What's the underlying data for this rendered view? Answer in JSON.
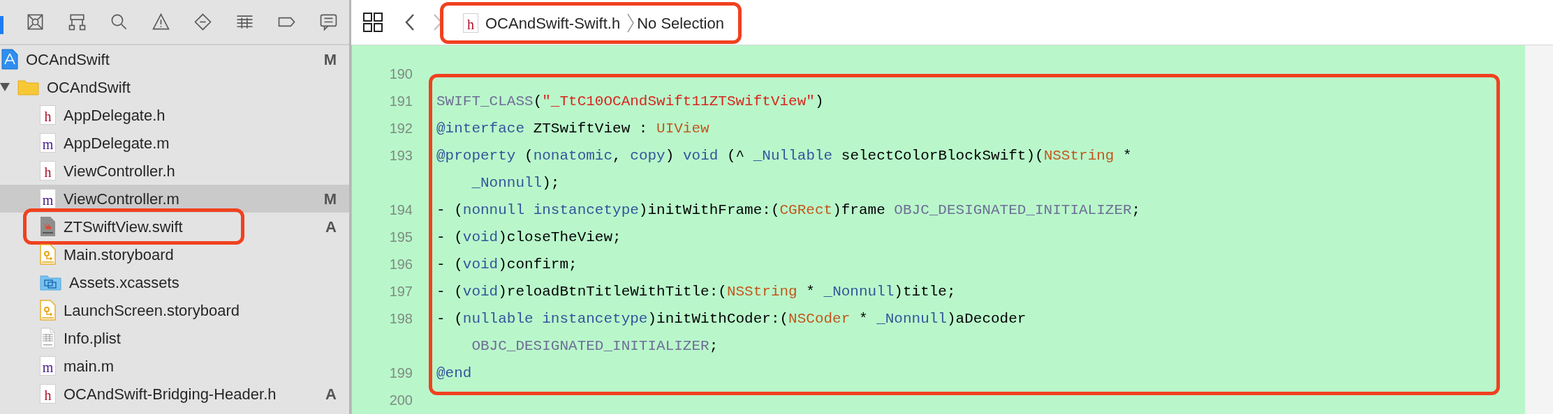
{
  "navigator": {
    "tree": [
      {
        "label": "OCAndSwift",
        "kind": "project",
        "status": "M",
        "selected": false,
        "highlighted": false
      },
      {
        "label": "OCAndSwift",
        "kind": "folder",
        "expanded": true,
        "selected": false,
        "highlighted": false,
        "children": [
          {
            "label": "AppDelegate.h",
            "kind": "header",
            "badge": "h",
            "selected": false,
            "highlighted": false
          },
          {
            "label": "AppDelegate.m",
            "kind": "source",
            "badge": "m",
            "selected": false,
            "highlighted": false
          },
          {
            "label": "ViewController.h",
            "kind": "header",
            "badge": "h",
            "selected": false,
            "highlighted": false
          },
          {
            "label": "ViewController.m",
            "kind": "source",
            "badge": "m",
            "status": "M",
            "selected": true,
            "highlighted": false
          },
          {
            "label": "ZTSwiftView.swift",
            "kind": "swift",
            "status": "A",
            "selected": false,
            "highlighted": true
          },
          {
            "label": "Main.storyboard",
            "kind": "storyboard",
            "selected": false,
            "highlighted": false
          },
          {
            "label": "Assets.xcassets",
            "kind": "assets",
            "selected": false,
            "highlighted": false
          },
          {
            "label": "LaunchScreen.storyboard",
            "kind": "storyboard",
            "selected": false,
            "highlighted": false
          },
          {
            "label": "Info.plist",
            "kind": "plist",
            "selected": false,
            "highlighted": false
          },
          {
            "label": "main.m",
            "kind": "source",
            "badge": "m",
            "selected": false,
            "highlighted": false
          },
          {
            "label": "OCAndSwift-Bridging-Header.h",
            "kind": "header",
            "badge": "h",
            "status": "A",
            "selected": false,
            "highlighted": false
          }
        ]
      }
    ]
  },
  "jump_bar": {
    "highlighted": true,
    "back_disabled": false,
    "forward_disabled": true,
    "file": {
      "badge": "h",
      "label": "OCAndSwift-Swift.h"
    },
    "symbol": "No Selection"
  },
  "code": {
    "lines": [
      {
        "number": "190",
        "highlighted": false
      },
      {
        "number": "191",
        "highlighted": true,
        "tokens": [
          {
            "t": "SWIFT_CLASS",
            "color": "#6e6e96"
          },
          {
            "t": "(",
            "color": "#000000"
          },
          {
            "t": "\"_TtC10OCAndSwift11ZTSwiftView\"",
            "color": "#d9261c"
          },
          {
            "t": ")",
            "color": "#000000"
          }
        ]
      },
      {
        "number": "192",
        "highlighted": true,
        "tokens": [
          {
            "t": "@interface",
            "color": "#34559a"
          },
          {
            "t": " ZTSwiftView : ",
            "color": "#000000"
          },
          {
            "t": "UIView",
            "color": "#c4561c"
          }
        ]
      },
      {
        "number": "193",
        "highlighted": true,
        "tokens": [
          {
            "t": "@property",
            "color": "#34559a"
          },
          {
            "t": " (",
            "color": "#000000"
          },
          {
            "t": "nonatomic",
            "color": "#34559a"
          },
          {
            "t": ", ",
            "color": "#000000"
          },
          {
            "t": "copy",
            "color": "#34559a"
          },
          {
            "t": ") ",
            "color": "#000000"
          },
          {
            "t": "void",
            "color": "#34559a"
          },
          {
            "t": " (^ ",
            "color": "#000000"
          },
          {
            "t": "_Nullable",
            "color": "#34559a"
          },
          {
            "t": " selectColorBlockSwift)(",
            "color": "#000000"
          },
          {
            "t": "NSString",
            "color": "#c4561c"
          },
          {
            "t": " * ",
            "color": "#000000"
          },
          {
            "t": "_Nonnull",
            "color": "#34559a"
          },
          {
            "t": ");",
            "color": "#000000"
          }
        ]
      },
      {
        "number": "194",
        "highlighted": true,
        "tokens": [
          {
            "t": "- (",
            "color": "#000000"
          },
          {
            "t": "nonnull instancetype",
            "color": "#34559a"
          },
          {
            "t": ")initWithFrame:(",
            "color": "#000000"
          },
          {
            "t": "CGRect",
            "color": "#c4561c"
          },
          {
            "t": ")frame ",
            "color": "#000000"
          },
          {
            "t": "OBJC_DESIGNATED_INITIALIZER",
            "color": "#6e6e96"
          },
          {
            "t": ";",
            "color": "#000000"
          }
        ]
      },
      {
        "number": "195",
        "highlighted": true,
        "tokens": [
          {
            "t": "- (",
            "color": "#000000"
          },
          {
            "t": "void",
            "color": "#34559a"
          },
          {
            "t": ")closeTheView;",
            "color": "#000000"
          }
        ]
      },
      {
        "number": "196",
        "highlighted": true,
        "tokens": [
          {
            "t": "- (",
            "color": "#000000"
          },
          {
            "t": "void",
            "color": "#34559a"
          },
          {
            "t": ")confirm;",
            "color": "#000000"
          }
        ]
      },
      {
        "number": "197",
        "highlighted": true,
        "tokens": [
          {
            "t": "- (",
            "color": "#000000"
          },
          {
            "t": "void",
            "color": "#34559a"
          },
          {
            "t": ")reloadBtnTitleWithTitle:(",
            "color": "#000000"
          },
          {
            "t": "NSString",
            "color": "#c4561c"
          },
          {
            "t": " * ",
            "color": "#000000"
          },
          {
            "t": "_Nonnull",
            "color": "#34559a"
          },
          {
            "t": ")title;",
            "color": "#000000"
          }
        ]
      },
      {
        "number": "198",
        "highlighted": true,
        "tokens": [
          {
            "t": "- (",
            "color": "#000000"
          },
          {
            "t": "nullable instancetype",
            "color": "#34559a"
          },
          {
            "t": ")initWithCoder:(",
            "color": "#000000"
          },
          {
            "t": "NSCoder",
            "color": "#c4561c"
          },
          {
            "t": " * ",
            "color": "#000000"
          },
          {
            "t": "_Nonnull",
            "color": "#34559a"
          },
          {
            "t": ")aDecoder ",
            "color": "#000000"
          },
          {
            "t": "OBJC_DESIGNATED_INITIALIZER",
            "color": "#6e6e96"
          },
          {
            "t": ";",
            "color": "#000000"
          }
        ]
      },
      {
        "number": "199",
        "highlighted": true,
        "tokens": [
          {
            "t": "@end",
            "color": "#34559a"
          }
        ]
      },
      {
        "number": "200",
        "highlighted": false
      }
    ]
  }
}
